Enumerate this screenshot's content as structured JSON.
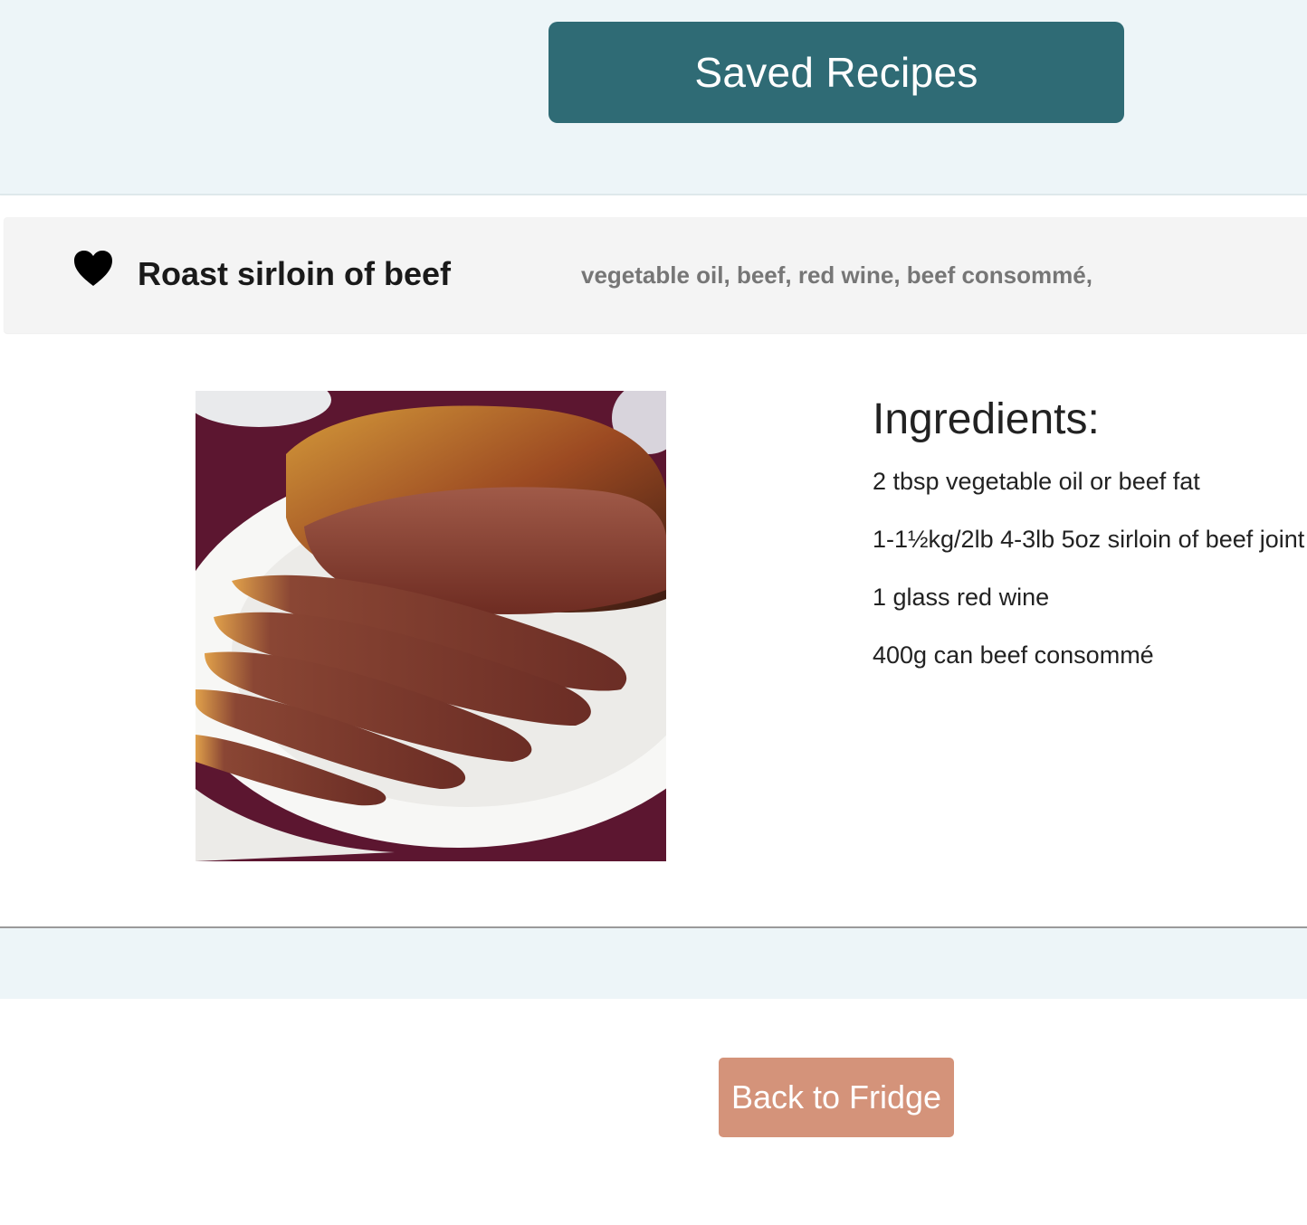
{
  "header": {
    "saved_recipes_label": "Saved Recipes"
  },
  "recipe": {
    "title": "Roast sirloin of beef",
    "summary": "vegetable oil, beef, red wine, beef consommé,",
    "favorite_icon": "heart-icon",
    "image_alt": "Sliced roast sirloin of beef on a white plate",
    "ingredients_heading": "Ingredients:",
    "ingredients": [
      "2 tbsp vegetable oil or beef fat",
      "1-1½kg/2lb 4-3lb 5oz sirloin of beef joint",
      "1 glass red wine",
      "400g can beef consommé"
    ]
  },
  "footer": {
    "back_label": "Back to Fridge"
  },
  "colors": {
    "saved_button": "#2f6b75",
    "back_button": "#d4937a",
    "band_background": "#edf5f8",
    "recipe_header_background": "#f4f4f4"
  }
}
